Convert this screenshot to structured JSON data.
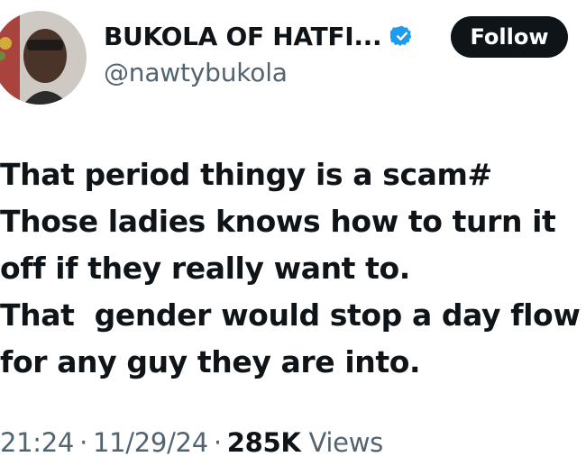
{
  "author": {
    "display_name": "BUKOLA OF HATFI...",
    "handle": "@nawtybukola",
    "verified_icon": "verified-badge-icon",
    "avatar": "profile-photo"
  },
  "follow_button": {
    "label": "Follow"
  },
  "tweet": {
    "lines": [
      "That period thingy is a scam#",
      "Those ladies knows how to turn it",
      "off if they really want to.",
      "That  gender would stop a day flow",
      "for any guy they are into."
    ]
  },
  "meta": {
    "time": "21:24",
    "separator": "·",
    "date": "11/29/24",
    "views_count": "285K",
    "views_label": "Views"
  },
  "colors": {
    "text_primary": "#0f1419",
    "text_secondary": "#536471",
    "verified_blue": "#1d9bf0",
    "button_bg": "#0f1419"
  }
}
